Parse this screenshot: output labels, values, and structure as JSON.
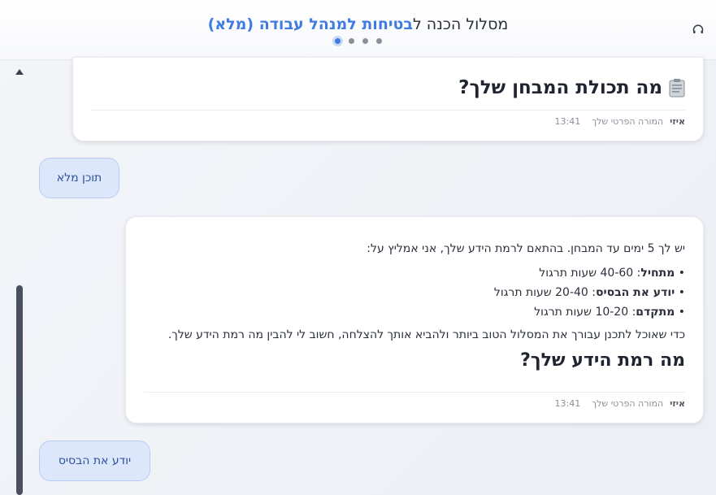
{
  "header": {
    "title_prefix": "מסלול הכנה ל",
    "title_accent": "בטיחות למנהל עבודה (מלא)",
    "refresh_icon": "refresh-icon",
    "accent_color": "#3f7be0"
  },
  "messages": {
    "card1": {
      "heading": "מה תכולת המבחן שלך?",
      "icon": "clipboard-icon",
      "sender": "איזי",
      "sender_role": "המורה הפרטי שלך",
      "time": "13:41"
    },
    "user1": {
      "text": "תוכן מלא"
    },
    "card2": {
      "intro": "יש לך 5 ימים עד המבחן. בהתאם לרמת הידע שלך, אני אמליץ על:",
      "bullets": [
        {
          "label": "מתחיל",
          "value": ": 40-60 שעות תרגול"
        },
        {
          "label": "יודע את הבסיס",
          "value": ": 20-40 שעות תרגול"
        },
        {
          "label": "מתקדם",
          "value": ": 10-20 שעות תרגול"
        }
      ],
      "body": "כדי שאוכל לתכנן עבורך את המסלול הטוב ביותר ולהביא אותך להצלחה, חשוב לי להבין מה רמת הידע שלך.",
      "heading": "מה רמת הידע שלך?",
      "sender": "איזי",
      "sender_role": "המורה הפרטי שלך",
      "time": "13:41"
    },
    "user2": {
      "text": "יודע את הבסיס"
    }
  }
}
